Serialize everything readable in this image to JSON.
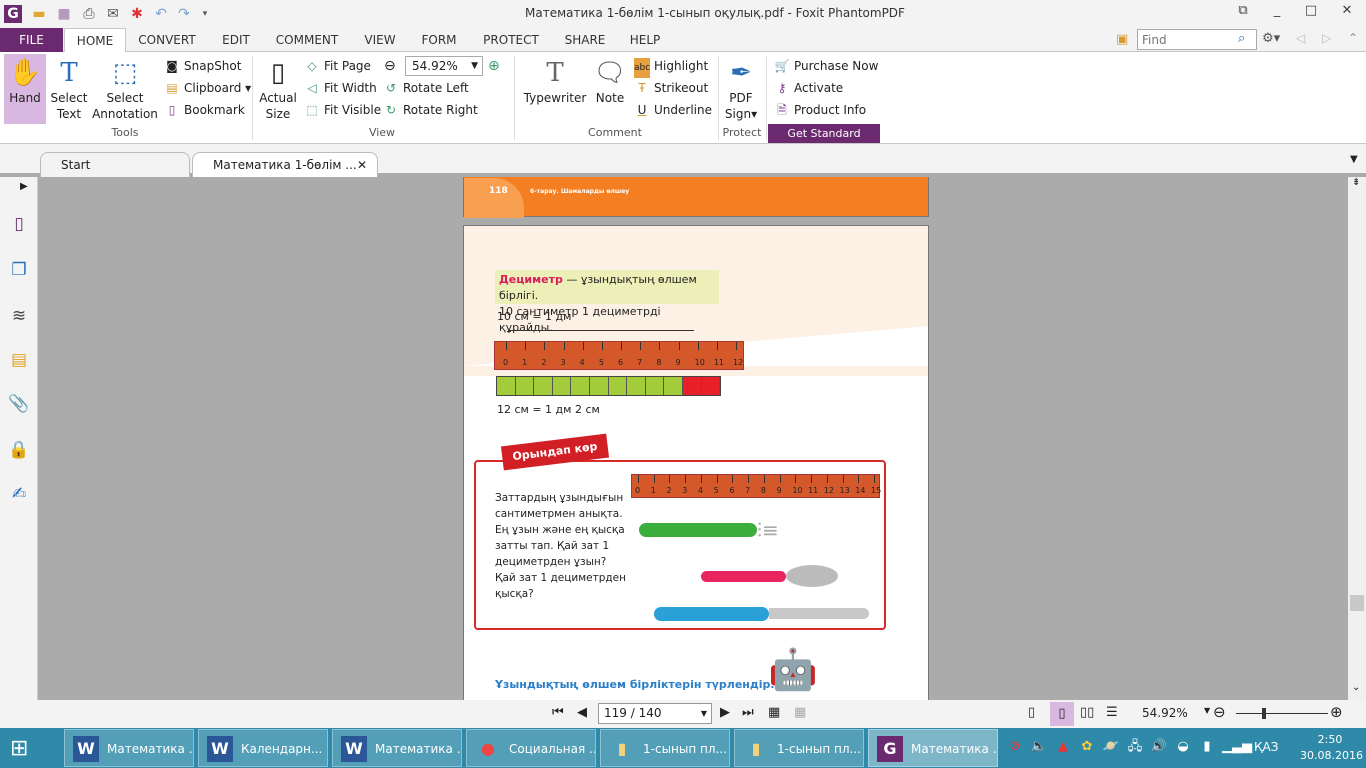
{
  "app": {
    "title": "Математика 1-бөлім 1-сынып оқулық.pdf - Foxit PhantomPDF",
    "accent": "#6b2a6f"
  },
  "quick_access": [
    "foxit-logo-icon",
    "open-folder-icon",
    "save-icon",
    "print-icon",
    "email-icon",
    "new-icon",
    "undo-icon",
    "redo-icon",
    "customize-icon"
  ],
  "menu": {
    "tabs": [
      "FILE",
      "HOME",
      "CONVERT",
      "EDIT",
      "COMMENT",
      "VIEW",
      "FORM",
      "PROTECT",
      "SHARE",
      "HELP"
    ],
    "active": "HOME",
    "find_placeholder": "Find"
  },
  "ribbon": {
    "tools": {
      "hand": "Hand",
      "select_text": [
        "Select",
        "Text"
      ],
      "select_annotation": [
        "Select",
        "Annotation"
      ],
      "snapshot": "SnapShot",
      "clipboard": "Clipboard",
      "bookmark": "Bookmark",
      "group": "Tools"
    },
    "view": {
      "actual_size": [
        "Actual",
        "Size"
      ],
      "fit_page": "Fit Page",
      "fit_width": "Fit Width",
      "fit_visible": "Fit Visible",
      "zoom": "54.92%",
      "rotate_left": "Rotate Left",
      "rotate_right": "Rotate Right",
      "group": "View"
    },
    "comment": {
      "typewriter": "Typewriter",
      "note": "Note",
      "highlight": "Highlight",
      "highlight_icon": "abc",
      "strikeout": "Strikeout",
      "underline": "Underline",
      "group": "Comment"
    },
    "protect": {
      "pdf_sign": [
        "PDF",
        "Sign"
      ],
      "group": "Protect"
    },
    "get_standard": {
      "purchase": "Purchase Now",
      "activate": "Activate",
      "product_info": "Product Info",
      "group": "Get Standard"
    }
  },
  "doc_tabs": [
    {
      "label": "Start"
    },
    {
      "label": "Математика 1-бөлім ..."
    }
  ],
  "page_prev": {
    "number": "118",
    "header": "6-тарау. Шамаларды өлшеу"
  },
  "page": {
    "def_term": "Дециметр",
    "def_rest": " — ұзындықтың өлшем бірлігі.",
    "def_line2": "10 сантиметр 1 дециметрді құрайды.",
    "eq1": "10 см  = 1 дм",
    "ruler1": [
      "0",
      "1",
      "2",
      "3",
      "4",
      "5",
      "6",
      "7",
      "8",
      "9",
      "10",
      "11",
      "12"
    ],
    "blocks": {
      "green": 10,
      "red": 2
    },
    "eq2": "12 см = 1 дм 2 см",
    "banner": "Орындап көр",
    "task": [
      "Заттардың ұзындығын",
      "сантиметрмен анықта.",
      "Ең ұзын және ең қысқа",
      "затты тап. Қай зат 1",
      "дециметрден ұзын?",
      "Қай зат 1 дециметрден",
      "қысқа?"
    ],
    "ruler2": [
      "0",
      "1",
      "2",
      "3",
      "4",
      "5",
      "6",
      "7",
      "8",
      "9",
      "10",
      "11",
      "12",
      "13",
      "14",
      "15"
    ],
    "heading": "Ұзындықтың өлшем бірліктерін түрлендір."
  },
  "status": {
    "page": "119 / 140",
    "zoom": "54.92%",
    "zoom_level": 0.3
  },
  "taskbar": {
    "items": [
      {
        "label": "Математика ...",
        "icon": "W"
      },
      {
        "label": "Календарн...",
        "icon": "W"
      },
      {
        "label": "Математика ...",
        "icon": "W"
      },
      {
        "label": "Социальная ...",
        "icon": "chrome"
      },
      {
        "label": "1-сынып пл...",
        "icon": "folder"
      },
      {
        "label": "1-сынып пл...",
        "icon": "folder"
      },
      {
        "label": "Математика ...",
        "icon": "foxit"
      }
    ],
    "lang": "ҚАЗ",
    "time": "2:50",
    "date": "30.08.2016"
  }
}
